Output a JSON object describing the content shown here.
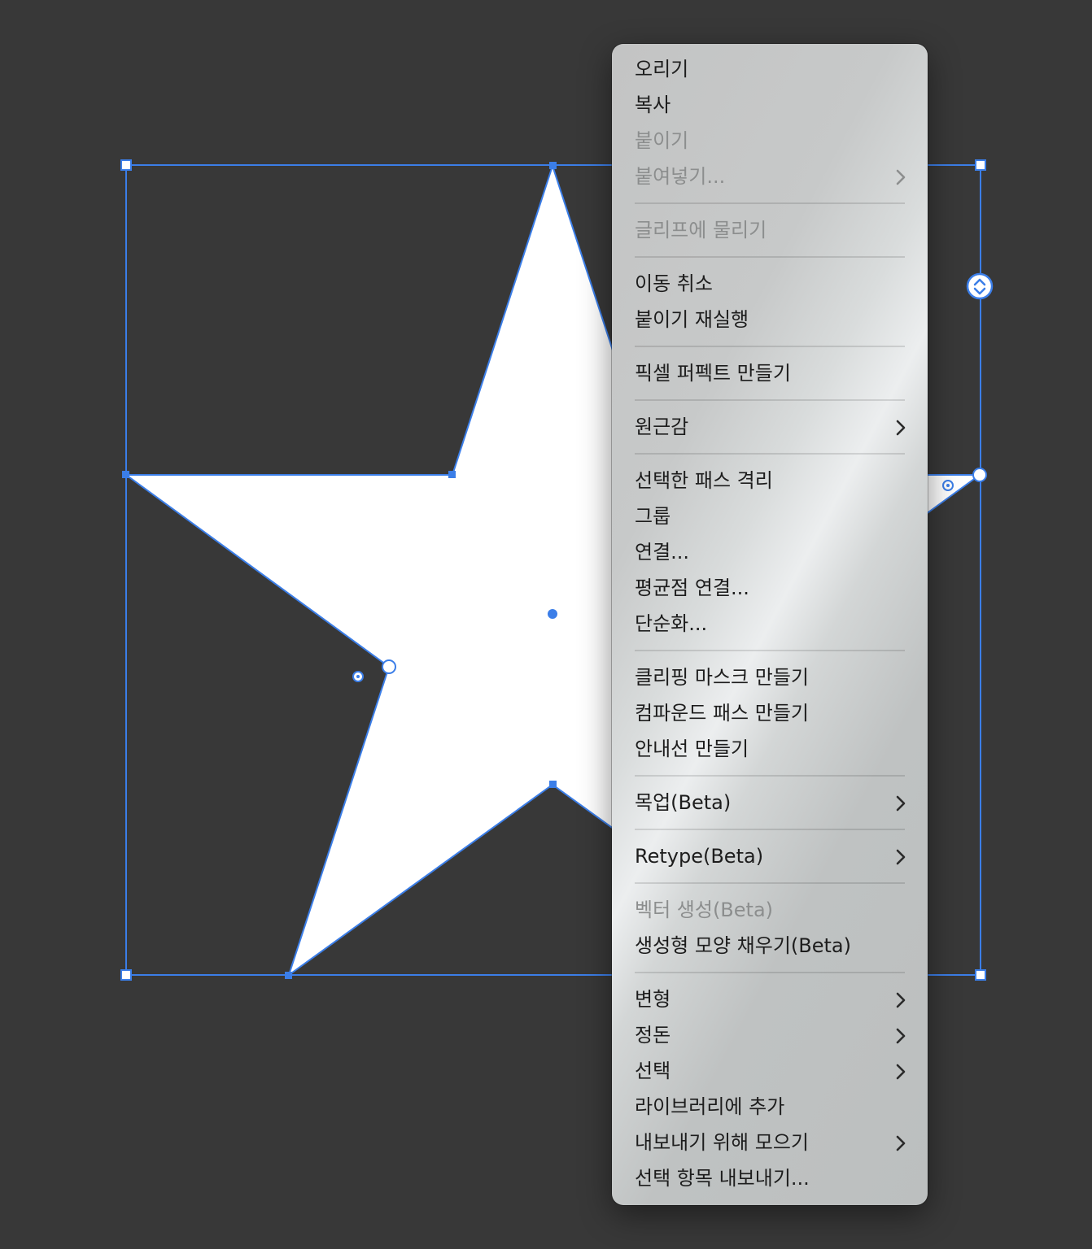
{
  "canvas": {
    "background": "#383838",
    "accent": "#3b7ee8",
    "shape_fill": "#ffffff"
  },
  "menu": {
    "items": [
      {
        "label": "오리기",
        "disabled": false,
        "submenu": false
      },
      {
        "label": "복사",
        "disabled": false,
        "submenu": false
      },
      {
        "label": "붙이기",
        "disabled": true,
        "submenu": false
      },
      {
        "label": "붙여넣기...",
        "disabled": true,
        "submenu": true
      },
      {
        "separator": true
      },
      {
        "label": "글리프에 물리기",
        "disabled": true,
        "submenu": false
      },
      {
        "separator": true
      },
      {
        "label": "이동 취소",
        "disabled": false,
        "submenu": false
      },
      {
        "label": "붙이기 재실행",
        "disabled": false,
        "submenu": false
      },
      {
        "separator": true
      },
      {
        "label": "픽셀 퍼펙트 만들기",
        "disabled": false,
        "submenu": false
      },
      {
        "separator": true
      },
      {
        "label": "원근감",
        "disabled": false,
        "submenu": true
      },
      {
        "separator": true
      },
      {
        "label": "선택한 패스 격리",
        "disabled": false,
        "submenu": false
      },
      {
        "label": "그룹",
        "disabled": false,
        "submenu": false
      },
      {
        "label": "연결...",
        "disabled": false,
        "submenu": false
      },
      {
        "label": "평균점 연결...",
        "disabled": false,
        "submenu": false
      },
      {
        "label": "단순화...",
        "disabled": false,
        "submenu": false
      },
      {
        "separator": true
      },
      {
        "label": "클리핑 마스크 만들기",
        "disabled": false,
        "submenu": false
      },
      {
        "label": "컴파운드 패스 만들기",
        "disabled": false,
        "submenu": false
      },
      {
        "label": "안내선 만들기",
        "disabled": false,
        "submenu": false
      },
      {
        "separator": true
      },
      {
        "label": "목업(Beta)",
        "disabled": false,
        "submenu": true
      },
      {
        "separator": true
      },
      {
        "label": "Retype(Beta)",
        "disabled": false,
        "submenu": true
      },
      {
        "separator": true
      },
      {
        "label": "벡터 생성(Beta)",
        "disabled": true,
        "submenu": false
      },
      {
        "label": "생성형 모양 채우기(Beta)",
        "disabled": false,
        "submenu": false
      },
      {
        "separator": true
      },
      {
        "label": "변형",
        "disabled": false,
        "submenu": true
      },
      {
        "label": "정돈",
        "disabled": false,
        "submenu": true
      },
      {
        "label": "선택",
        "disabled": false,
        "submenu": true
      },
      {
        "label": "라이브러리에 추가",
        "disabled": false,
        "submenu": false
      },
      {
        "label": "내보내기 위해 모으기",
        "disabled": false,
        "submenu": true
      },
      {
        "label": "선택 항목 내보내기...",
        "disabled": false,
        "submenu": false
      }
    ]
  }
}
